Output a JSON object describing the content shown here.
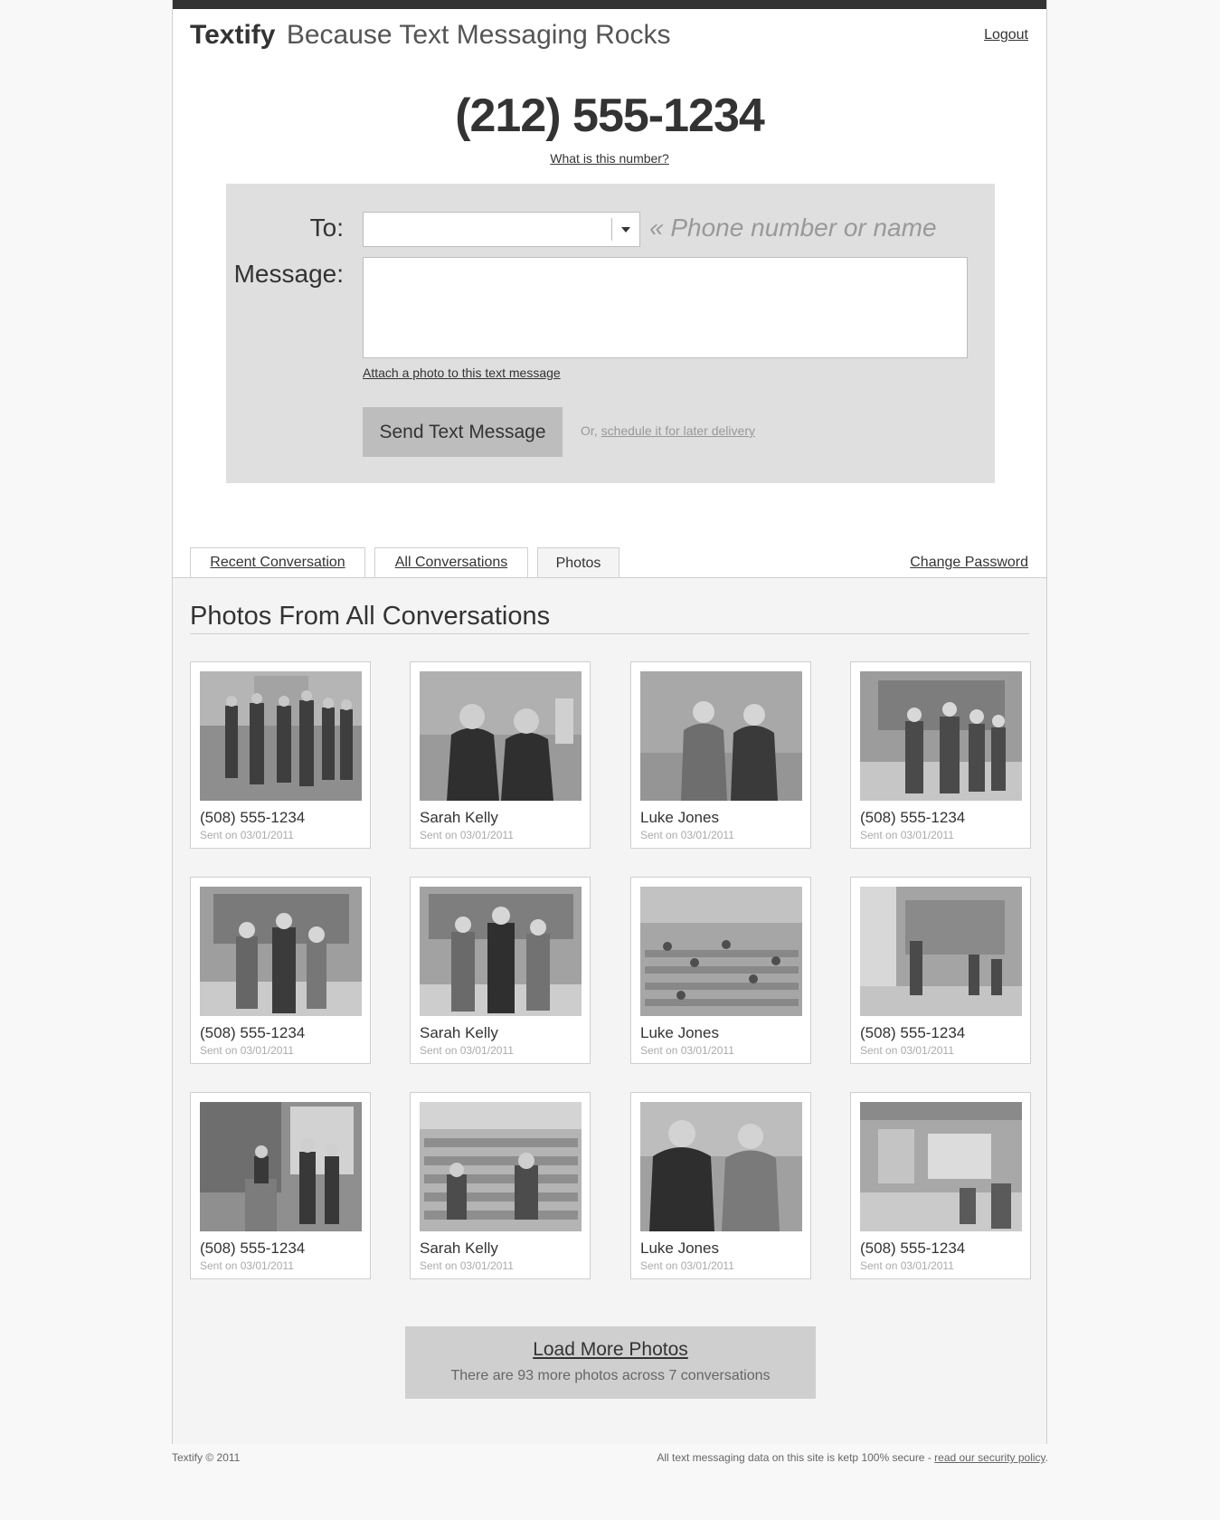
{
  "header": {
    "brand_name": "Textify",
    "tagline": "Because Text Messaging Rocks",
    "logout_label": "Logout"
  },
  "number": {
    "value": "(212) 555-1234",
    "help_link": "What is this number?"
  },
  "compose": {
    "to_label": "To:",
    "to_value": "",
    "to_hint": "« Phone number or name",
    "message_label": "Message:",
    "message_value": "",
    "attach_link": "Attach a photo to this text message",
    "send_button": "Send Text Message",
    "schedule_prefix": "Or, ",
    "schedule_link": "schedule it for later delivery"
  },
  "tabs": [
    {
      "label": "Recent Conversation",
      "active": false
    },
    {
      "label": "All Conversations",
      "active": false
    },
    {
      "label": "Photos",
      "active": true
    }
  ],
  "change_password": "Change Password",
  "photos": {
    "title": "Photos From All Conversations",
    "items": [
      {
        "sender": "(508) 555-1234",
        "sent": "Sent on 03/01/2011"
      },
      {
        "sender": "Sarah Kelly",
        "sent": "Sent on 03/01/2011"
      },
      {
        "sender": "Luke Jones",
        "sent": "Sent on 03/01/2011"
      },
      {
        "sender": "(508) 555-1234",
        "sent": "Sent on 03/01/2011"
      },
      {
        "sender": "(508) 555-1234",
        "sent": "Sent on 03/01/2011"
      },
      {
        "sender": "Sarah Kelly",
        "sent": "Sent on 03/01/2011"
      },
      {
        "sender": "Luke Jones",
        "sent": "Sent on 03/01/2011"
      },
      {
        "sender": "(508) 555-1234",
        "sent": "Sent on 03/01/2011"
      },
      {
        "sender": "(508) 555-1234",
        "sent": "Sent on 03/01/2011"
      },
      {
        "sender": "Sarah Kelly",
        "sent": "Sent on 03/01/2011"
      },
      {
        "sender": "Luke Jones",
        "sent": "Sent on 03/01/2011"
      },
      {
        "sender": "(508) 555-1234",
        "sent": "Sent on 03/01/2011"
      }
    ],
    "load_more_label": "Load More Photos",
    "load_more_detail": "There are 93 more photos across 7 conversations"
  },
  "footer": {
    "copyright": "Textify © 2011",
    "security_text": "All text messaging data on this site is ketp 100% secure - ",
    "security_link": "read our security policy",
    "security_suffix": "."
  },
  "colors": {
    "topbar": "#333333",
    "compose_bg": "#dfdfdf",
    "button_bg": "#bdbdbd",
    "panel_bg": "#f4f4f4"
  }
}
